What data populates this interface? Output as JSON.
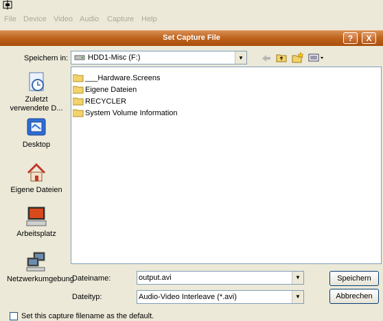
{
  "app": {
    "menu": [
      "File",
      "Device",
      "Video",
      "Audio",
      "Capture",
      "Help"
    ]
  },
  "dialog": {
    "title": "Set Capture File",
    "title_buttons": [
      "?",
      "X"
    ],
    "look_in_label": "Speichern in:",
    "look_in_value": "HDD1-Misc (F:)",
    "places": [
      {
        "label": "Zuletzt verwendete D...",
        "icon": "recent-documents-icon"
      },
      {
        "label": "Desktop",
        "icon": "desktop-icon"
      },
      {
        "label": "Eigene Dateien",
        "icon": "my-documents-icon"
      },
      {
        "label": "Arbeitsplatz",
        "icon": "my-computer-icon"
      },
      {
        "label": "Netzwerkumgebung",
        "icon": "network-places-icon"
      }
    ],
    "files": [
      "___Hardware.Screens",
      "Eigene Dateien",
      "RECYCLER",
      "System Volume Information"
    ],
    "filename_label": "Dateiname:",
    "filename_value": "output.avi",
    "filetype_label": "Dateityp:",
    "filetype_value": "Audio-Video Interleave (*.avi)",
    "save_button": "Speichern",
    "cancel_button": "Abbrechen",
    "default_checkbox_label": "Set this capture filename as the default.",
    "default_checked": false
  }
}
